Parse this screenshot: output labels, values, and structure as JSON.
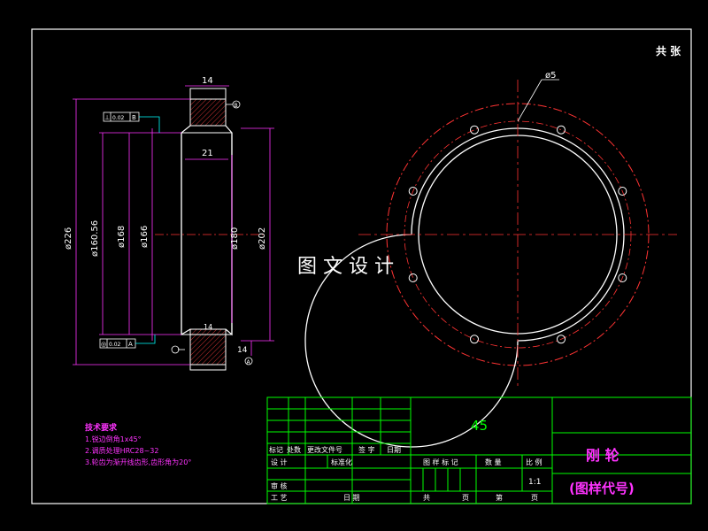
{
  "watermark": "图 文 设 计",
  "sheet_note": "共 张",
  "front_view": {
    "dims": {
      "top_width": "14",
      "bottom_width": "14",
      "inner_width": "21",
      "d226": "ø226",
      "d160": "ø160.56",
      "d168": "ø168",
      "d166": "ø166",
      "d180": "ø180",
      "d202": "ø202",
      "bottom_note": "14"
    },
    "datum": "B",
    "datum_a": "A",
    "frame_top": {
      "symbol": "⊥",
      "value": "0.02",
      "ref": "B"
    },
    "frame_bottom": {
      "symbol": "◎",
      "value": "0.02",
      "ref": "A"
    }
  },
  "side_view": {
    "hole_label": "ø5"
  },
  "tech_req": {
    "title": "技术要求",
    "items": [
      "1.锐边倒角1x45°",
      "2.调质处理HRC28~32",
      "3.轮齿为渐开线齿形,齿形角为20°"
    ]
  },
  "title_block": {
    "material": "45",
    "part_name": "刚  轮",
    "drawing_code": "(图样代号)",
    "scale": "1:1",
    "rev_headers": [
      "标记",
      "处数",
      "更改文件号",
      "签  字",
      "日期"
    ],
    "labels": {
      "design": "设  计",
      "standard": "标准化",
      "review": "审  核",
      "process": "工  艺",
      "date": "日  期",
      "stage_mark": "图 样 标 记",
      "qty": "数  量",
      "scale_lbl": "比  例",
      "total": "共",
      "sheet": "页",
      "page_no": "第",
      "page": "页"
    }
  }
}
